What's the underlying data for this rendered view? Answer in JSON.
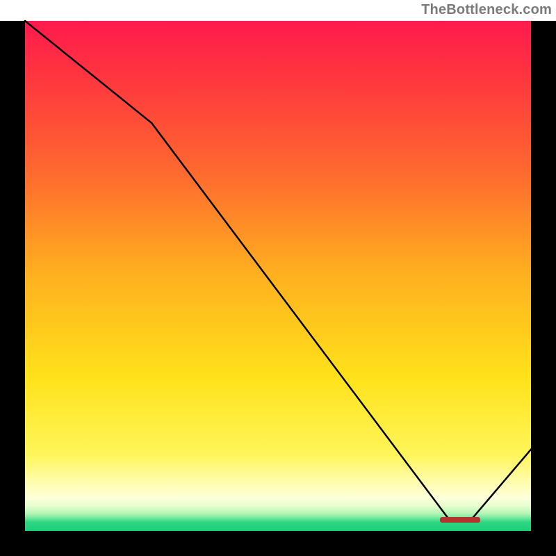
{
  "watermark": "TheBottleneck.com",
  "colors": {
    "frame": "#000000",
    "gradient_top": "#ff1a4d",
    "gradient_mid": "#ffe21a",
    "gradient_bottom": "#19cf78",
    "curve": "#000000",
    "marker": "#b4332f"
  },
  "chart_data": {
    "type": "line",
    "title": "",
    "xlabel": "",
    "ylabel": "",
    "xlim": [
      0,
      100
    ],
    "ylim": [
      0,
      100
    ],
    "series": [
      {
        "name": "bottleneck-curve",
        "x": [
          0,
          25,
          84,
          88,
          100
        ],
        "values": [
          100,
          80,
          2,
          2,
          16
        ]
      }
    ],
    "annotations": [
      {
        "name": "optimal-range-marker",
        "x_start": 82,
        "x_end": 90,
        "y": 2.2
      }
    ]
  }
}
